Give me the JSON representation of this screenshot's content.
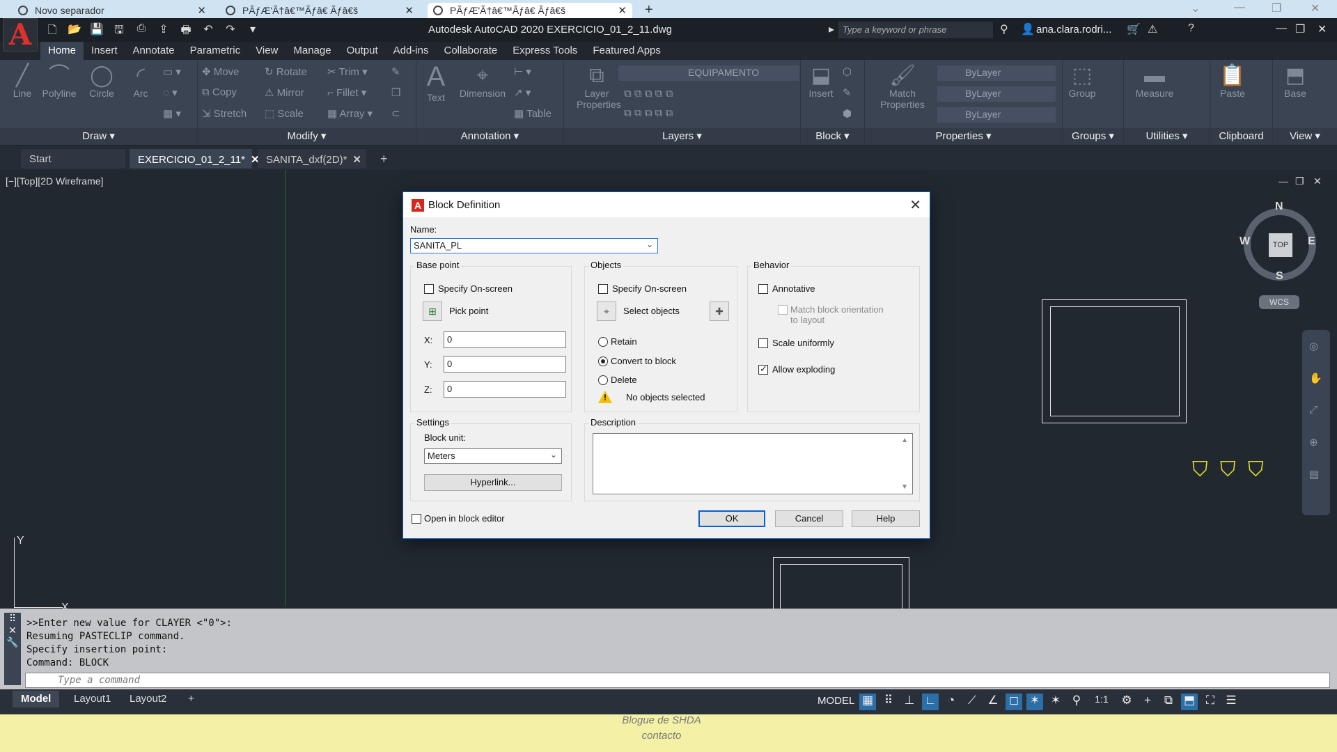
{
  "browser": {
    "tabs": [
      {
        "label": "Novo separador"
      },
      {
        "label": "PÃƒÆ'Ã†â€™Ãƒâ€ Ãƒâ€š"
      },
      {
        "label": "PÃƒÆ'Ã†â€™Ãƒâ€ Ãƒâ€š"
      }
    ]
  },
  "app": {
    "title": "Autodesk AutoCAD 2020    EXERCICIO_01_2_11.dwg",
    "search_placeholder": "Type a keyword or phrase",
    "user": "ana.clara.rodri...",
    "logo_letter": "A"
  },
  "ribbon": {
    "tabs": [
      "Home",
      "Insert",
      "Annotate",
      "Parametric",
      "View",
      "Manage",
      "Output",
      "Add-ins",
      "Collaborate",
      "Express Tools",
      "Featured Apps"
    ],
    "panels": {
      "draw": {
        "title": "Draw",
        "tools": [
          "Line",
          "Polyline",
          "Circle",
          "Arc"
        ]
      },
      "modify": {
        "title": "Modify",
        "tools": [
          "Move",
          "Rotate",
          "Trim",
          "Copy",
          "Mirror",
          "Fillet",
          "Stretch",
          "Scale",
          "Array"
        ]
      },
      "annotation": {
        "title": "Annotation",
        "tools": [
          "Text",
          "Dimension",
          "Table"
        ]
      },
      "layers": {
        "title": "Layers",
        "tool": "Layer Properties",
        "current_layer": "EQUIPAMENTO"
      },
      "block": {
        "title": "Block",
        "tool": "Insert"
      },
      "properties": {
        "title": "Properties",
        "tool": "Match Properties",
        "color": "ByLayer",
        "linetype": "ByLayer",
        "lineweight": "ByLayer"
      },
      "groups": {
        "title": "Groups",
        "tool": "Group"
      },
      "utilities": {
        "title": "Utilities",
        "tool": "Measure"
      },
      "clipboard": {
        "title": "Clipboard",
        "tool": "Paste"
      },
      "view": {
        "title": "View",
        "tool": "Base"
      }
    }
  },
  "file_tabs": [
    {
      "label": "Start"
    },
    {
      "label": "EXERCICIO_01_2_11*"
    },
    {
      "label": "SANITA_dxf(2D)*"
    }
  ],
  "viewport": {
    "label": "[−][Top][2D Wireframe]",
    "compass": {
      "n": "N",
      "s": "S",
      "e": "E",
      "w": "W",
      "top": "TOP"
    },
    "wcs": "WCS",
    "ucs_x": "X",
    "ucs_y": "Y"
  },
  "dialog": {
    "title": "Block Definition",
    "name_label": "Name:",
    "name_value": "SANITA_PL",
    "base_point": {
      "title": "Base point",
      "specify_onscreen": "Specify On-screen",
      "pick_point": "Pick point",
      "x_label": "X:",
      "x_value": "0",
      "y_label": "Y:",
      "y_value": "0",
      "z_label": "Z:",
      "z_value": "0"
    },
    "objects": {
      "title": "Objects",
      "specify_onscreen": "Specify On-screen",
      "select_objects": "Select objects",
      "retain": "Retain",
      "convert": "Convert to block",
      "delete": "Delete",
      "status": "No objects selected"
    },
    "behavior": {
      "title": "Behavior",
      "annotative": "Annotative",
      "match_orientation": "Match block orientation",
      "match_orientation_2": "to layout",
      "scale_uniformly": "Scale uniformly",
      "allow_exploding": "Allow exploding"
    },
    "settings": {
      "title": "Settings",
      "block_unit_label": "Block unit:",
      "block_unit_value": "Meters",
      "hyperlink": "Hyperlink..."
    },
    "description_label": "Description",
    "open_in_editor": "Open in block editor",
    "ok": "OK",
    "cancel": "Cancel",
    "help": "Help"
  },
  "command": {
    "history": [
      ">>Enter new value for CLAYER <\"0\">:",
      "Resuming PASTECLIP command.",
      "Specify insertion point:",
      "Command: BLOCK"
    ],
    "placeholder": "Type a command"
  },
  "status": {
    "layout_tabs": [
      "Model",
      "Layout1",
      "Layout2"
    ],
    "model_label": "MODEL",
    "scale": "1:1"
  },
  "footer": {
    "line1": "Blogue de SHDA",
    "line2": "contacto"
  }
}
